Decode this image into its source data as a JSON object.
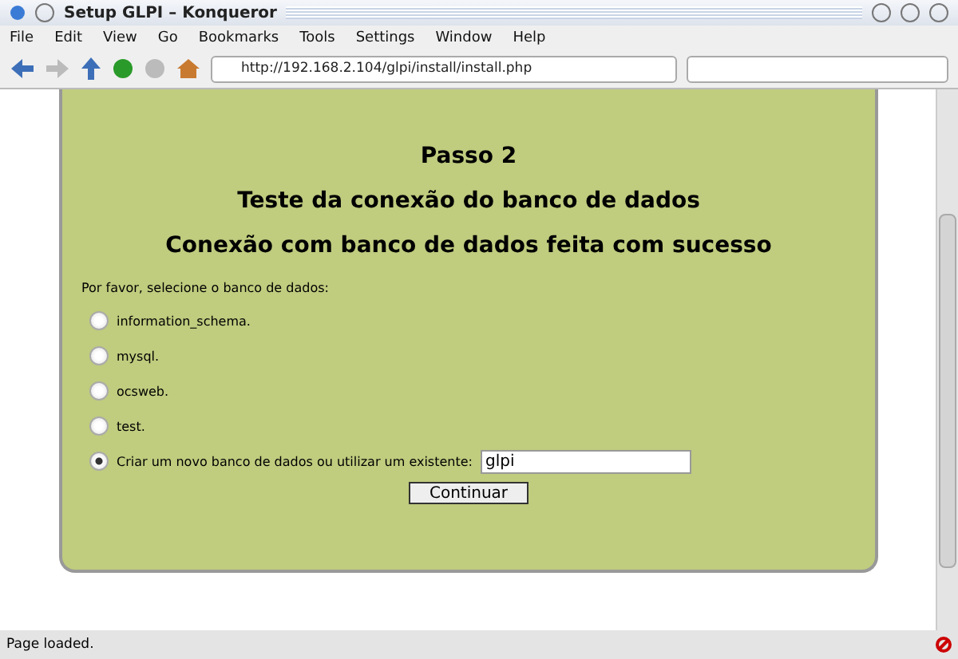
{
  "window": {
    "title": "Setup GLPI – Konqueror"
  },
  "menu": [
    "File",
    "Edit",
    "View",
    "Go",
    "Bookmarks",
    "Tools",
    "Settings",
    "Window",
    "Help"
  ],
  "address": {
    "value": "http://192.168.2.104/glpi/install/install.php"
  },
  "page": {
    "headings": [
      "Passo 2",
      "Teste da conexão do banco de dados",
      "Conexão com banco de dados feita com sucesso"
    ],
    "prompt": "Por favor, selecione o banco de dados:",
    "options": [
      {
        "label": "information_schema.",
        "selected": false
      },
      {
        "label": "mysql.",
        "selected": false
      },
      {
        "label": "ocsweb.",
        "selected": false
      },
      {
        "label": "test.",
        "selected": false
      },
      {
        "label": "Criar um novo banco de dados ou utilizar um existente:",
        "selected": true
      }
    ],
    "new_db": {
      "value": "glpi"
    },
    "button": "Continuar"
  },
  "status_bar": "Page loaded."
}
